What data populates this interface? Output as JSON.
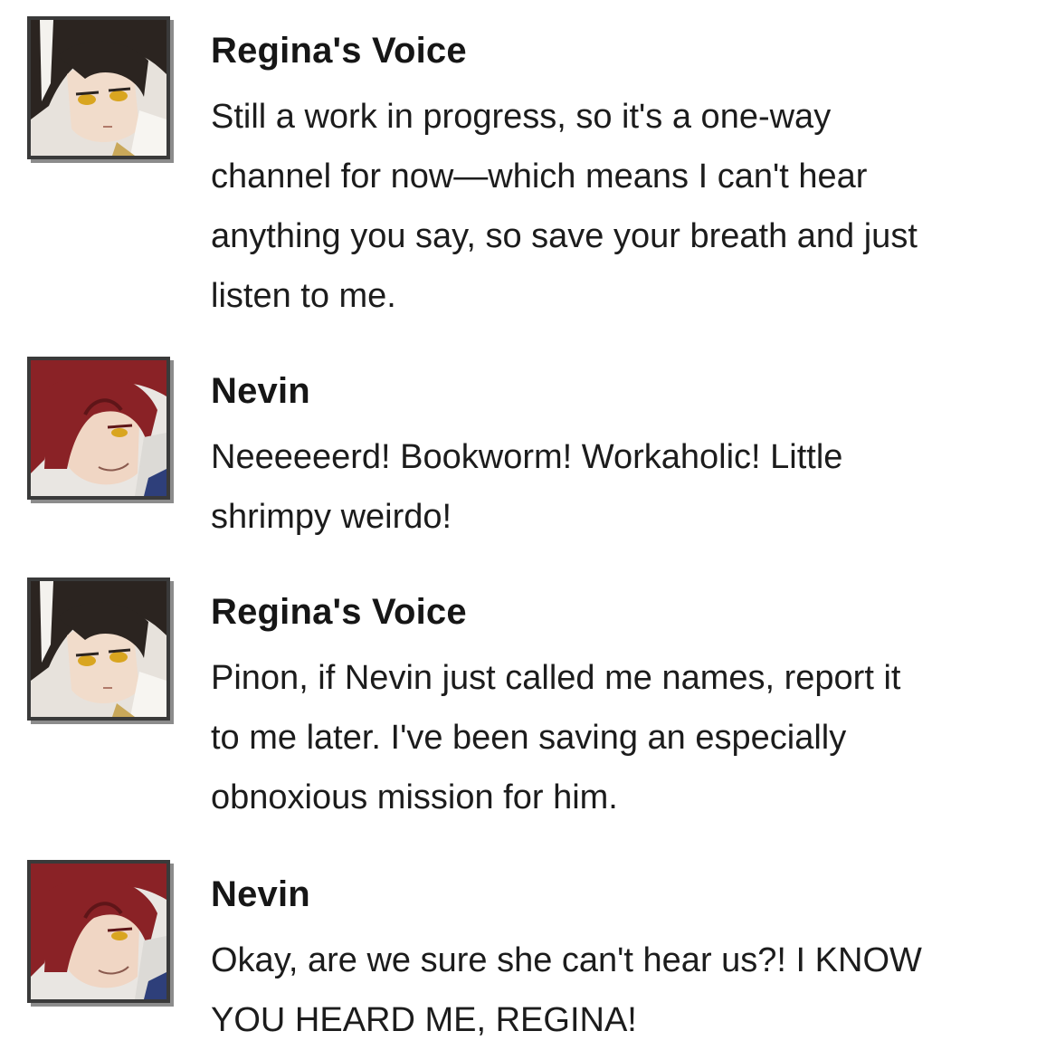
{
  "messages": [
    {
      "speaker": "Regina's Voice",
      "avatar": "regina-avatar",
      "lines": [
        "Still a work in progress, so it's a one-way",
        "channel for now—which means I can't hear",
        "anything you say, so save your breath and just",
        "listen to me."
      ]
    },
    {
      "speaker": "Nevin",
      "avatar": "nevin-avatar",
      "lines": [
        "Neeeeeerd! Bookworm! Workaholic! Little",
        "shrimpy weirdo!"
      ]
    },
    {
      "speaker": "Regina's Voice",
      "avatar": "regina-avatar",
      "lines": [
        "Pinon, if Nevin just called me names, report it",
        "to me later. I've been saving an especially",
        "obnoxious mission for him."
      ]
    },
    {
      "speaker": "Nevin",
      "avatar": "nevin-avatar",
      "lines": [
        "Okay, are we sure she can't hear us?! I KNOW",
        "YOU HEARD ME, REGINA!"
      ]
    }
  ],
  "colors": {
    "text": "#1c1c1c",
    "avatar_border": "#3a3a3a",
    "regina_hair": "#2b2420",
    "nevin_hair": "#8a2226",
    "eye": "#d9a520"
  }
}
